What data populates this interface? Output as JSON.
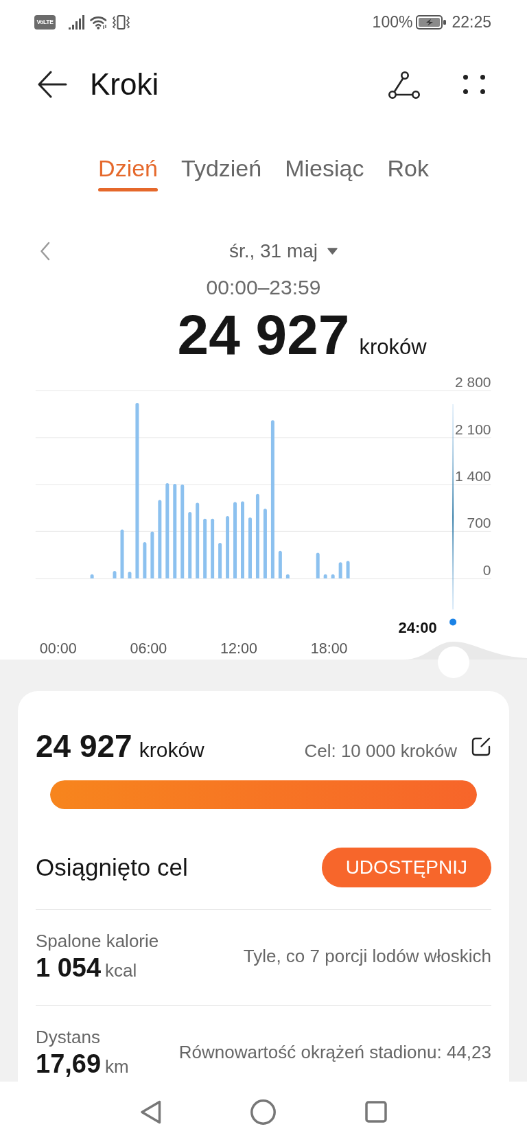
{
  "status_bar": {
    "network_badge": "VoLTE",
    "battery": "100%",
    "time": "22:25"
  },
  "header": {
    "title": "Kroki"
  },
  "tabs": [
    {
      "label": "Dzień",
      "selected": true
    },
    {
      "label": "Tydzień",
      "selected": false
    },
    {
      "label": "Miesiąc",
      "selected": false
    },
    {
      "label": "Rok",
      "selected": false
    }
  ],
  "date_nav": {
    "date": "śr., 31 maj",
    "range": "00:00–23:59"
  },
  "total": {
    "value": "24 927",
    "unit": "kroków"
  },
  "chart": {
    "cursor_label": "24:00",
    "chart_data": {
      "type": "bar",
      "grid": true,
      "x": [
        2.25,
        3.75,
        4.25,
        4.75,
        5.25,
        5.75,
        6.25,
        6.75,
        7.25,
        7.75,
        8.25,
        8.75,
        9.25,
        9.75,
        10.25,
        10.75,
        11.25,
        11.75,
        12.25,
        12.75,
        13.25,
        13.75,
        14.25,
        14.75,
        15.25,
        17.25,
        17.75,
        18.25,
        18.75,
        19.25
      ],
      "values": [
        60,
        110,
        730,
        100,
        2620,
        540,
        700,
        1170,
        1420,
        1410,
        1400,
        990,
        1130,
        890,
        890,
        530,
        930,
        1140,
        1150,
        910,
        1260,
        1040,
        2360,
        410,
        60,
        380,
        60,
        60,
        240,
        260
      ],
      "xlim": [
        -1.5,
        28.75
      ],
      "ylim": [
        0,
        2800
      ],
      "xticks": [
        {
          "value": 0,
          "label": "00:00"
        },
        {
          "value": 6,
          "label": "06:00"
        },
        {
          "value": 12,
          "label": "12:00"
        },
        {
          "value": 18,
          "label": "18:00"
        }
      ],
      "yticks": [
        {
          "value": 0,
          "label": "0"
        },
        {
          "value": 700,
          "label": "700"
        },
        {
          "value": 1400,
          "label": "1 400"
        },
        {
          "value": 2100,
          "label": "2 100"
        },
        {
          "value": 2800,
          "label": "2 800"
        }
      ]
    }
  },
  "summary": {
    "steps": "24 927",
    "unit": "kroków",
    "goal": "Cel: 10 000 kroków",
    "level": 1,
    "status": "Osiągnięto cel",
    "share_button": "UDOSTĘPNIJ"
  },
  "stats": [
    {
      "label": "Spalone kalorie",
      "value": "1 054",
      "unit": "kcal",
      "comparison": "Tyle, co 7 porcji lodów włoskich"
    },
    {
      "label": "Dystans",
      "value": "17,69",
      "unit": "km",
      "comparison": "Równowartość okrążeń stadionu: 44,23"
    }
  ]
}
